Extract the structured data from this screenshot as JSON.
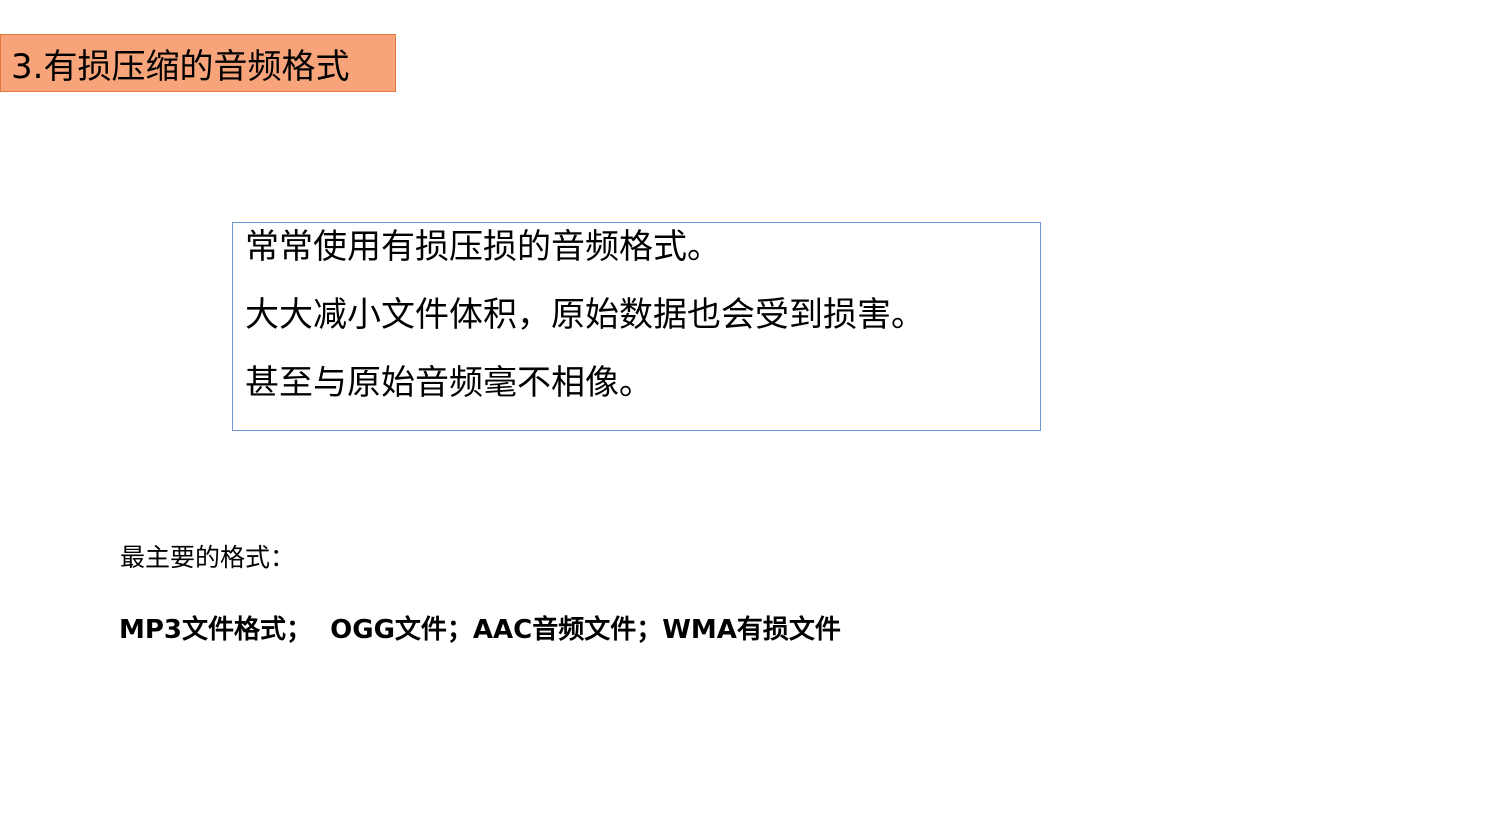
{
  "heading": {
    "text": "3.有损压缩的音频格式",
    "background_color": "#f7a47a",
    "border_color": "#e07a3e"
  },
  "note_box": {
    "border_color": "#6f97d6",
    "lines": [
      "常常使用有损压损的音频格式。",
      "大大减小文件体积，原始数据也会受到损害。",
      "甚至与原始音频毫不相像。"
    ]
  },
  "formats": {
    "label": "最主要的格式：",
    "list": "MP3文件格式；  OGG文件；AAC音频文件；WMA有损文件"
  }
}
